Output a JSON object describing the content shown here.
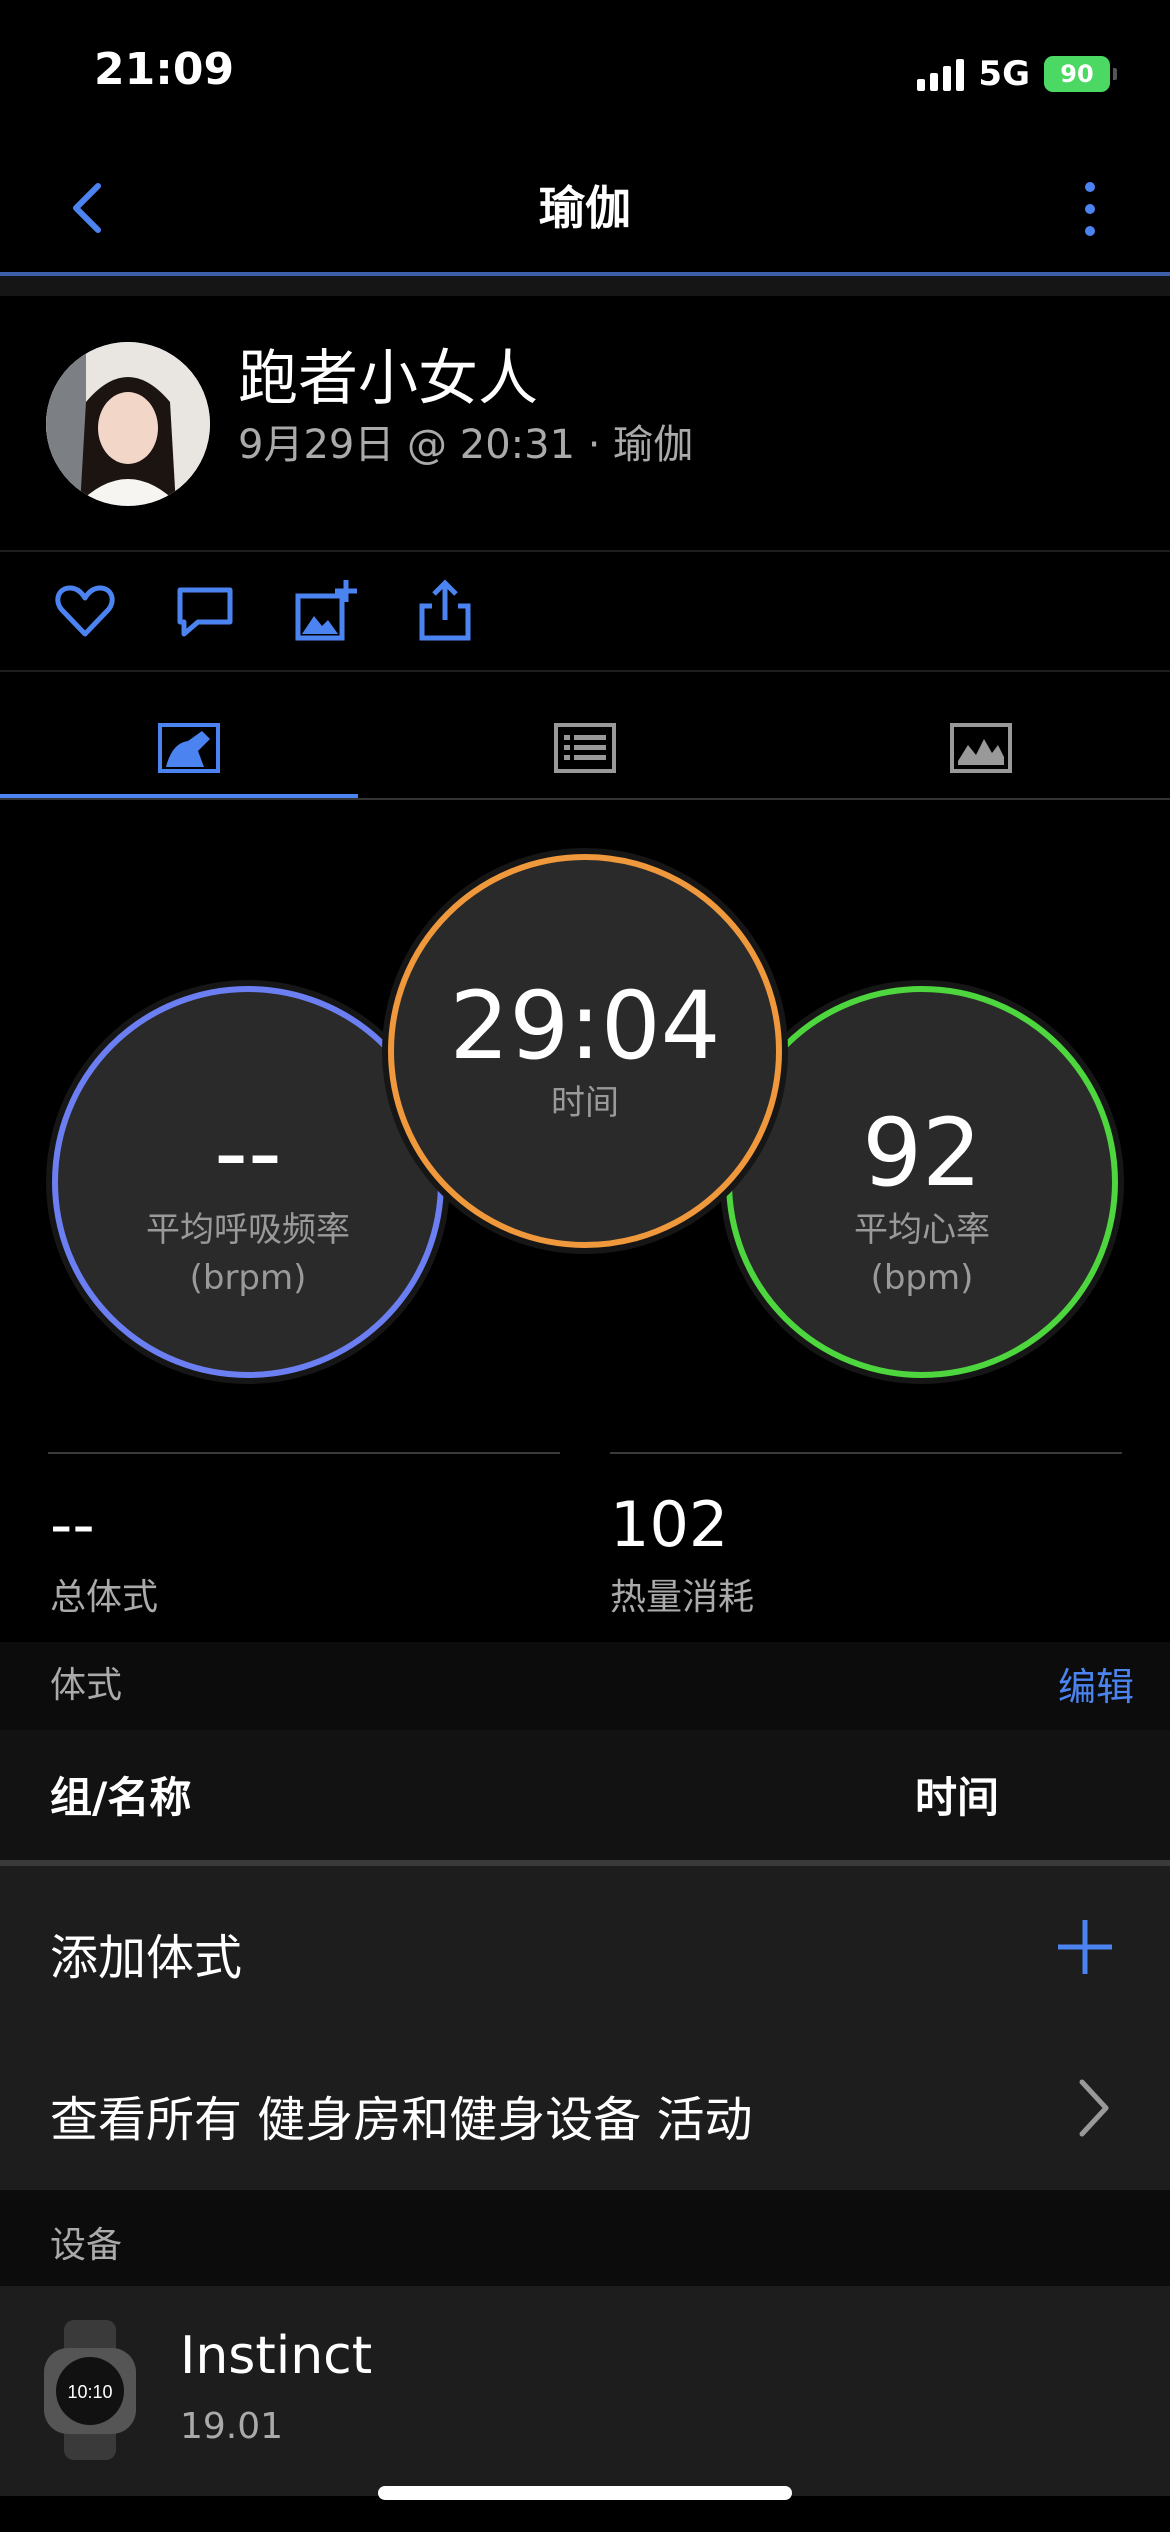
{
  "status_bar": {
    "time": "21:09",
    "network": "5G",
    "battery": "90"
  },
  "nav": {
    "title": "瑜伽"
  },
  "profile": {
    "name": "跑者小女人",
    "subtitle": "9月29日 @ 20:31 · 瑜伽"
  },
  "metrics": {
    "duration": {
      "value": "29:04",
      "label": "时间"
    },
    "breathing": {
      "value": "--",
      "label": "平均呼吸频率",
      "unit": "(brpm)"
    },
    "heart_rate": {
      "value": "92",
      "label": "平均心率",
      "unit": "(bpm)"
    }
  },
  "stats": {
    "total_poses": {
      "value": "--",
      "label": "总体式"
    },
    "calories": {
      "value": "102",
      "label": "热量消耗"
    }
  },
  "poses_section": {
    "title": "体式",
    "edit": "编辑",
    "col_name": "组/名称",
    "col_time": "时间",
    "add_pose": "添加体式",
    "view_all": "查看所有 健身房和健身设备 活动"
  },
  "devices_section": {
    "title": "设备",
    "device": {
      "name": "Instinct",
      "version": "19.01"
    }
  },
  "colors": {
    "accent": "#4b84f0",
    "duration_ring": "#f0983c",
    "heart_ring": "#4dd63e",
    "breath_ring": "#6c7ff2",
    "battery": "#4bd964"
  },
  "icons": [
    "back-icon",
    "more-icon",
    "heart-icon",
    "comment-icon",
    "add-photo-icon",
    "share-icon",
    "summary-tab-icon",
    "details-tab-icon",
    "chart-tab-icon",
    "plus-icon",
    "chevron-right-icon",
    "watch-icon"
  ]
}
